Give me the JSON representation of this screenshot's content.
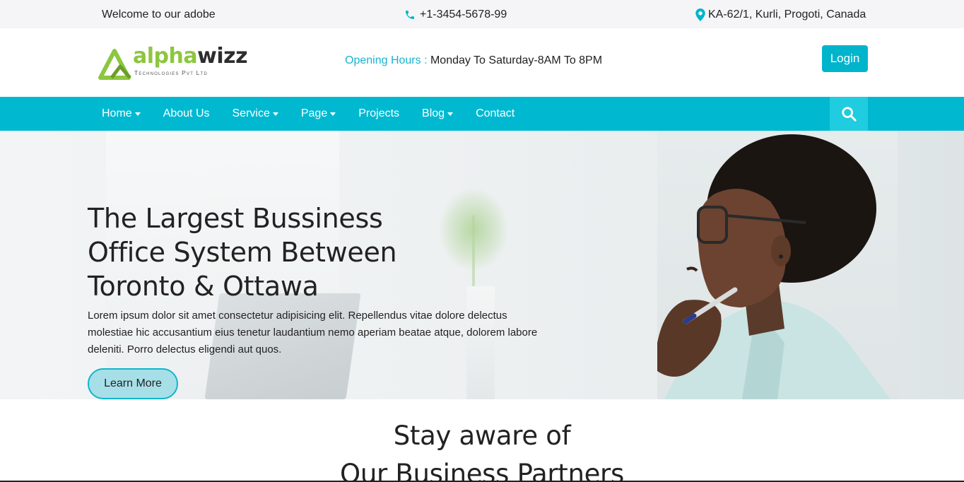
{
  "topbar": {
    "welcome": "Welcome to our adobe",
    "phone": "+1-3454-5678-99",
    "address": "KA-62/1, Kurli, Progoti, Canada",
    "icon_color": "#00b4cc"
  },
  "header": {
    "logo": {
      "part1": "alpha",
      "part2": "wizz",
      "tagline": "Technologies Pvt Ltd"
    },
    "hours_label": "Opening Hours :",
    "hours_value": "Monday To Saturday-8AM To 8PM",
    "login_label": "Login"
  },
  "nav": {
    "items": [
      {
        "label": "Home",
        "dropdown": true
      },
      {
        "label": "About Us",
        "dropdown": false
      },
      {
        "label": "Service",
        "dropdown": true
      },
      {
        "label": "Page",
        "dropdown": true
      },
      {
        "label": "Projects",
        "dropdown": false
      },
      {
        "label": "Blog",
        "dropdown": true
      },
      {
        "label": "Contact",
        "dropdown": false
      }
    ],
    "search_icon": "search-icon",
    "bg_color": "#00b9d1"
  },
  "hero": {
    "title_lines": [
      "The Largest Bussiness",
      "Office System Between",
      "Toronto & Ottawa"
    ],
    "description": "Lorem ipsum dolor sit amet consectetur adipisicing elit. Repellendus vitae dolore delectus molestiae hic accusantium eius tenetur laudantium nemo aperiam beatae atque, dolorem labore deleniti. Porro delectus eligendi aut quos.",
    "button_label": "Learn More"
  },
  "section": {
    "title_line1": "Stay aware of",
    "title_line2": "Our Business Partners"
  },
  "colors": {
    "accent": "#00b4cc",
    "logo_green": "#8dc63f"
  }
}
